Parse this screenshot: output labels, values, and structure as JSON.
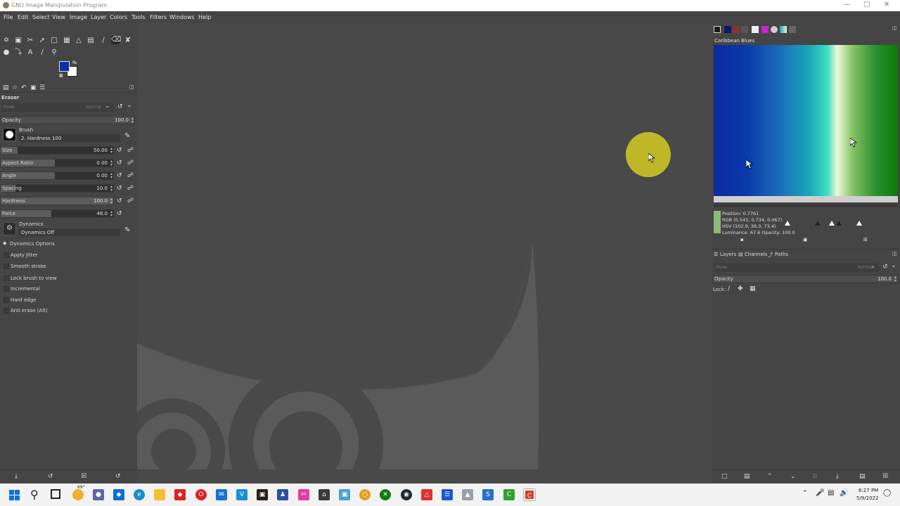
{
  "window": {
    "title": "GNU Image Manipulation Program"
  },
  "menu": [
    "File",
    "Edit",
    "Select",
    "View",
    "Image",
    "Layer",
    "Colors",
    "Tools",
    "Filters",
    "Windows",
    "Help"
  ],
  "colors": {
    "foreground": "#0b2fa6",
    "background": "#ffffff",
    "ui_bg": "#454545"
  },
  "tool_options": {
    "tool_name": "Eraser",
    "mode_label": "Mode",
    "mode_value": "Normal",
    "opacity_label": "Opacity",
    "opacity_value": "100.0",
    "brush_label": "Brush",
    "brush_name": "2. Hardness 100",
    "sliders": [
      {
        "label": "Size",
        "value": "50.00",
        "fraction": 0.05
      },
      {
        "label": "Aspect Ratio",
        "value": "0.00",
        "fraction": 0.5
      },
      {
        "label": "Angle",
        "value": "0.00",
        "fraction": 0.5
      },
      {
        "label": "Spacing",
        "value": "10.0",
        "fraction": 0.05
      },
      {
        "label": "Hardness",
        "value": "100.0",
        "fraction": 1.0
      },
      {
        "label": "Force",
        "value": "48.0",
        "fraction": 0.48
      }
    ],
    "dynamics_label": "Dynamics",
    "dynamics_value": "Dynamics Off",
    "dynamics_options_label": "Dynamics Options",
    "checkboxes": [
      "Apply Jitter",
      "Smooth stroke",
      "Lock brush to view",
      "Incremental",
      "Hard edge",
      "Anti erase  (Alt)"
    ]
  },
  "gradient": {
    "name": "Caribbean Blues",
    "position": "Position: 0.7761",
    "rgb": "RGB (0.543, 0.734, 0.467)",
    "hsv": "HSV (102.9, 36.3, 73.4)",
    "luminance": "Luminance: 67.6    Opacity: 100.0",
    "swatch_color": "#8bbb77"
  },
  "layers": {
    "tabs": [
      "Layers",
      "Channels",
      "Paths"
    ],
    "mode_label": "Mode",
    "mode_value": "Normal",
    "opacity_label": "Opacity",
    "opacity_value": "100.0",
    "lock_label": "Lock:"
  },
  "taskbar": {
    "weather": "69°",
    "time": "6:27 PM",
    "date": "5/9/2022"
  }
}
